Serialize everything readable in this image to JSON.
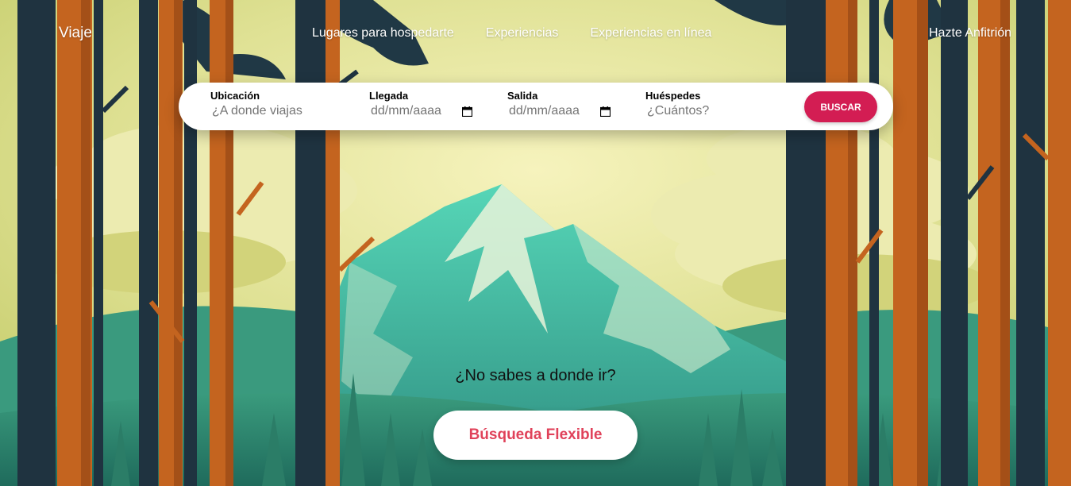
{
  "nav": {
    "logo": "Viaje",
    "links": [
      "Lugares para hospedarte",
      "Experiencias",
      "Experiencias en línea"
    ],
    "host": "Hazte Anfitrión"
  },
  "search": {
    "location": {
      "label": "Ubicación",
      "placeholder": "¿A donde viajas"
    },
    "checkin": {
      "label": "Llegada",
      "value": "dd/mm/aaaa"
    },
    "checkout": {
      "label": "Salida",
      "value": "dd/mm/aaaa"
    },
    "guests": {
      "label": "Huéspedes",
      "placeholder": "¿Cuántos?"
    },
    "button": "BUSCAR"
  },
  "cta": {
    "question": "¿No sabes a donde ir?",
    "button": "Búsqueda Flexible"
  },
  "colors": {
    "accent": "#d31d53",
    "flex_text": "#e0425a",
    "sky": "#d8de8a",
    "mountain": "#3aa692",
    "trunk_orange": "#c4641f",
    "trunk_dark": "#1f3340"
  },
  "icons": [
    "calendar-icon"
  ]
}
